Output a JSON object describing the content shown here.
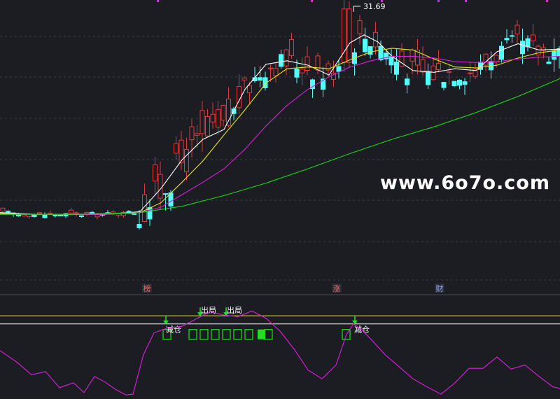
{
  "chart_data": [
    {
      "type": "candlestick",
      "peak_label": "31.69",
      "up_color": "#e0393e",
      "down_color": "#54ffff",
      "ma_series": [
        {
          "color": "#ffffff",
          "x": [
            0,
            50,
            100,
            150,
            200,
            230,
            260,
            290,
            320,
            350,
            380,
            410,
            440,
            470,
            500,
            520,
            540,
            560,
            590,
            620,
            650,
            680,
            710,
            740,
            770,
            800
          ],
          "values": [
            10.2,
            10.0,
            10.0,
            10.0,
            10.3,
            12.9,
            16.1,
            18.4,
            19.5,
            24.0,
            26.8,
            27.2,
            26.7,
            25.6,
            29.2,
            30.1,
            29.3,
            27.7,
            26.1,
            25.9,
            26.3,
            26.1,
            28.2,
            29.1,
            28.4,
            28.5
          ]
        },
        {
          "color": "#e8e800",
          "x": [
            0,
            50,
            100,
            150,
            200,
            230,
            260,
            290,
            320,
            350,
            380,
            410,
            440,
            470,
            500,
            530,
            560,
            590,
            620,
            650,
            680,
            710,
            740,
            770,
            800
          ],
          "values": [
            10.1,
            10.0,
            10.0,
            10.0,
            10.2,
            11.3,
            13.6,
            16.0,
            18.9,
            21.7,
            24.7,
            26.3,
            26.5,
            26.3,
            27.3,
            28.2,
            28.6,
            28.4,
            27.4,
            26.5,
            26.4,
            26.7,
            27.5,
            28.1,
            28.4
          ]
        },
        {
          "color": "#d61fd6",
          "x": [
            0,
            50,
            100,
            150,
            200,
            230,
            260,
            290,
            320,
            350,
            380,
            410,
            440,
            470,
            500,
            530,
            560,
            590,
            620,
            650,
            680,
            710,
            740,
            770,
            800
          ],
          "values": [
            10.0,
            10.0,
            10.0,
            10.0,
            10.2,
            10.8,
            12.2,
            13.6,
            15.1,
            17.3,
            19.9,
            22.2,
            24.0,
            25.4,
            26.5,
            27.2,
            27.7,
            27.7,
            27.5,
            27.1,
            27.0,
            27.1,
            27.4,
            27.6,
            27.7
          ]
        },
        {
          "color": "#18d818",
          "x": [
            0,
            100,
            200,
            260,
            320,
            380,
            440,
            500,
            560,
            620,
            680,
            740,
            800
          ],
          "values": [
            10.0,
            10.0,
            10.2,
            10.9,
            12.1,
            13.5,
            15.1,
            16.8,
            18.4,
            19.8,
            21.4,
            23.2,
            25.2
          ]
        }
      ],
      "ylim": [
        5,
        34
      ]
    },
    {
      "type": "line",
      "series": [
        {
          "color": "#e01ee0",
          "x": [
            0,
            25,
            45,
            65,
            85,
            105,
            120,
            135,
            150,
            165,
            180,
            190,
            205,
            220,
            240,
            260,
            280,
            300,
            320,
            340,
            360,
            380,
            400,
            420,
            440,
            460,
            480,
            495,
            505,
            515,
            530,
            550,
            570,
            590,
            610,
            630,
            650,
            670,
            690,
            710,
            730,
            750,
            770,
            790,
            800
          ],
          "values": [
            60,
            45,
            30,
            34,
            14,
            20,
            8,
            28,
            21,
            12,
            5,
            6,
            55,
            82,
            88,
            90,
            99,
            108,
            104,
            102,
            109,
            100,
            84,
            62,
            36,
            25,
            42,
            80,
            93,
            87,
            74,
            55,
            40,
            25,
            15,
            6,
            20,
            38,
            38,
            52,
            37,
            42,
            28,
            15,
            13
          ]
        }
      ],
      "ylim": [
        0,
        130
      ],
      "reference_lines": [
        {
          "value": 103,
          "color": "#e8e800"
        },
        {
          "value": 93,
          "color": "#ffffff"
        }
      ]
    }
  ],
  "signals": {
    "tags": [
      {
        "text": "榜",
        "x": 210,
        "color": "#e07070"
      },
      {
        "text": "涨",
        "x": 481,
        "color": "#e07070"
      },
      {
        "text": "财",
        "x": 628,
        "color": "#8ab4ff"
      }
    ],
    "labels": [
      {
        "text": "出局",
        "x": 298,
        "value": 103,
        "y_offset": -8
      },
      {
        "text": "出局",
        "x": 335,
        "value": 103,
        "y_offset": -8
      },
      {
        "text": "减仓",
        "x": 248,
        "value": 93,
        "y_offset": 8
      },
      {
        "text": "减仓",
        "x": 517,
        "value": 93,
        "y_offset": 8
      }
    ],
    "arrows": [
      {
        "x": 237,
        "value": 93
      },
      {
        "x": 286,
        "value": 103
      },
      {
        "x": 323,
        "value": 103
      },
      {
        "x": 507,
        "value": 93
      }
    ],
    "outline_boxes": [
      233,
      270,
      286,
      302,
      318,
      334,
      350,
      378,
      489
    ],
    "filled_boxes": [
      368
    ]
  },
  "watermark": "www.6o7o.com"
}
